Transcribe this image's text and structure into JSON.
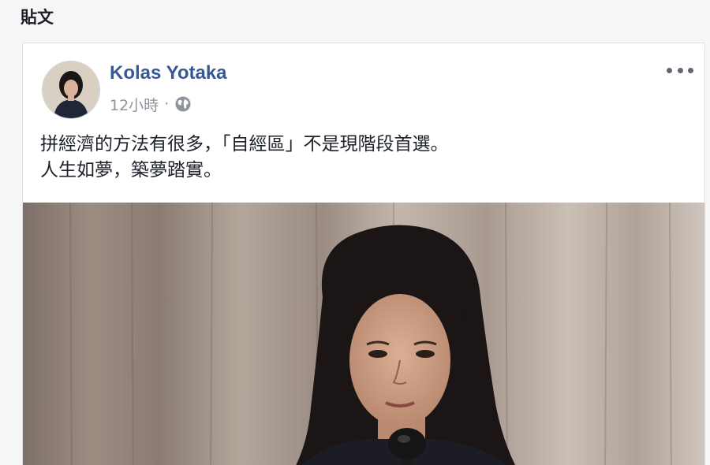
{
  "section": {
    "title": "貼文"
  },
  "post": {
    "author": "Kolas Yotaka",
    "timestamp": "12小時",
    "separator": "·",
    "privacy_icon": "globe-icon",
    "more_icon": "more-options-icon",
    "text_lines": [
      "拼經濟的方法有很多，「自經區」不是現階段首選。",
      "人生如夢，築夢踏實。"
    ]
  },
  "colors": {
    "author_link": "#365899",
    "meta_gray": "#90949c",
    "card_border": "#dddfe2",
    "page_background": "#f5f6f7"
  }
}
